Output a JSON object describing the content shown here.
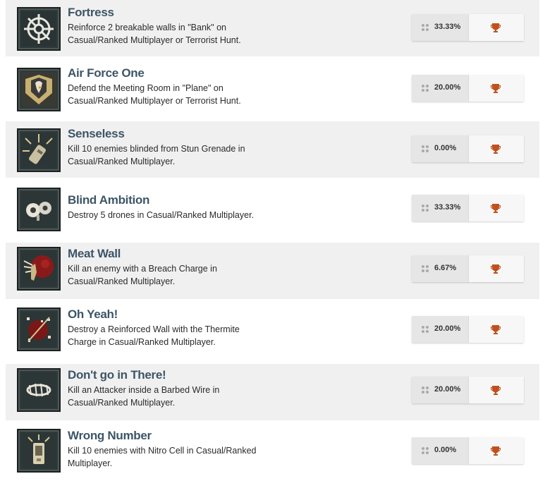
{
  "achievements": [
    {
      "title": "Fortress",
      "desc_line1": "Reinforce 2 breakable walls in \"Bank\" on",
      "desc_line2": "Casual/Ranked Multiplayer or Terrorist Hunt.",
      "percent": "33.33%",
      "icon": "barricade-star-icon",
      "trophy": "bronze"
    },
    {
      "title": "Air Force One",
      "desc_line1": "Defend the Meeting Room in \"Plane\" on",
      "desc_line2": "Casual/Ranked Multiplayer or Terrorist Hunt.",
      "percent": "20.00%",
      "icon": "eagle-shield-icon",
      "trophy": "bronze"
    },
    {
      "title": "Senseless",
      "desc_line1": "Kill 10 enemies blinded from Stun Grenade in",
      "desc_line2": "Casual/Ranked Multiplayer.",
      "percent": "0.00%",
      "icon": "stun-grenade-icon",
      "trophy": "bronze"
    },
    {
      "title": "Blind Ambition",
      "desc_line1": "Destroy 5 drones in Casual/Ranked Multiplayer.",
      "desc_line2": "",
      "percent": "33.33%",
      "icon": "drone-icon",
      "trophy": "bronze"
    },
    {
      "title": "Meat Wall",
      "desc_line1": "Kill an enemy with a Breach Charge in",
      "desc_line2": "Casual/Ranked Multiplayer.",
      "percent": "6.67%",
      "icon": "breach-blast-icon",
      "trophy": "bronze"
    },
    {
      "title": "Oh Yeah!",
      "desc_line1": "Destroy a Reinforced Wall with the Thermite",
      "desc_line2": "Charge in Casual/Ranked Multiplayer.",
      "percent": "20.00%",
      "icon": "thermite-breach-icon",
      "trophy": "bronze"
    },
    {
      "title": "Don't go in There!",
      "desc_line1": "Kill an Attacker inside a Barbed Wire in",
      "desc_line2": "Casual/Ranked Multiplayer.",
      "percent": "20.00%",
      "icon": "barbed-wire-icon",
      "trophy": "bronze"
    },
    {
      "title": "Wrong Number",
      "desc_line1": "Kill 10 enemies with Nitro Cell in Casual/Ranked",
      "desc_line2": "Multiplayer.",
      "percent": "0.00%",
      "icon": "nitro-cell-icon",
      "trophy": "bronze"
    }
  ],
  "colors": {
    "title": "#3d5566",
    "trophy": "#c0501d",
    "row_shaded": "#f0f0f0"
  }
}
